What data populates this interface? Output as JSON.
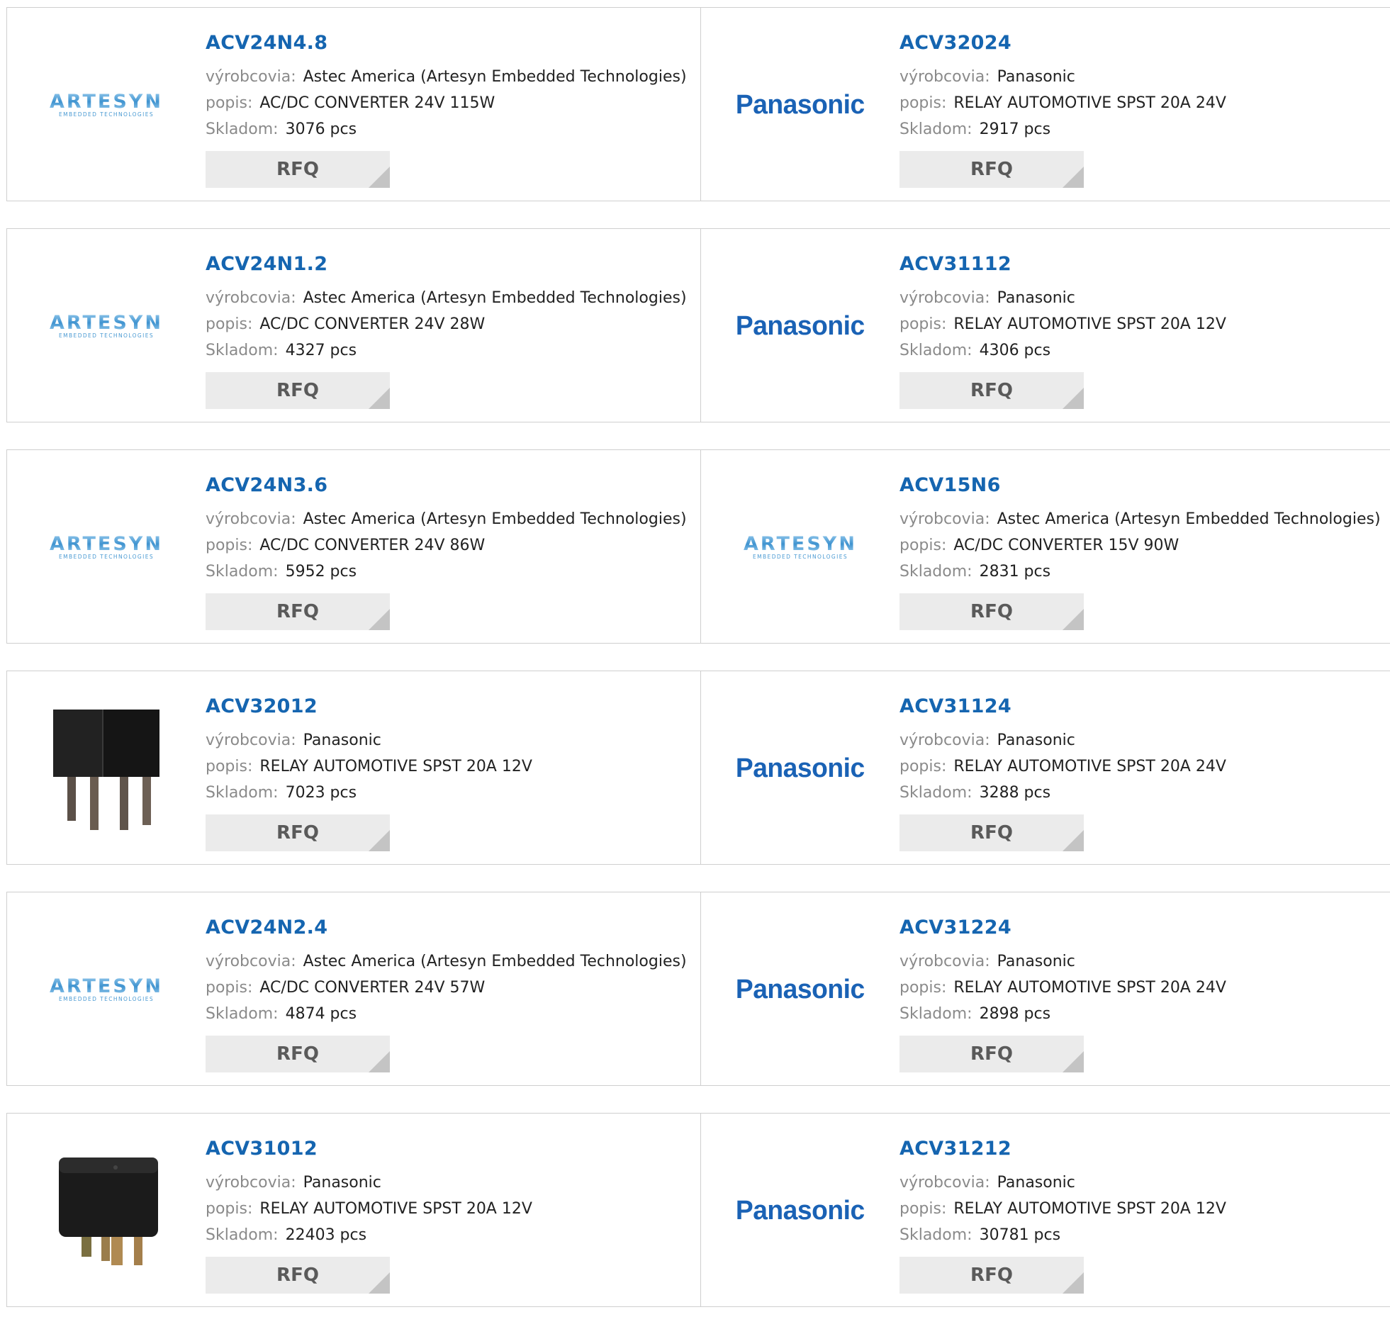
{
  "labels": {
    "manufacturer": "výrobcovia:",
    "description": "popis:",
    "stock": "Skladom:",
    "rfq": "RFQ"
  },
  "brand_colors": {
    "link": "#1565b0",
    "panasonic": "#1a62b5",
    "artesyn": "#5aa5d6"
  },
  "products": [
    {
      "part": "ACV24N4.8",
      "manufacturer": "Astec America (Artesyn Embedded Technologies)",
      "description": "AC/DC CONVERTER 24V 115W",
      "stock": "3076 pcs",
      "image": "artesyn-logo"
    },
    {
      "part": "ACV32024",
      "manufacturer": "Panasonic",
      "description": "RELAY AUTOMOTIVE SPST 20A 24V",
      "stock": "2917 pcs",
      "image": "panasonic-logo"
    },
    {
      "part": "ACV24N1.2",
      "manufacturer": "Astec America (Artesyn Embedded Technologies)",
      "description": "AC/DC CONVERTER 24V 28W",
      "stock": "4327 pcs",
      "image": "artesyn-logo"
    },
    {
      "part": "ACV31112",
      "manufacturer": "Panasonic",
      "description": "RELAY AUTOMOTIVE SPST 20A 12V",
      "stock": "4306 pcs",
      "image": "panasonic-logo"
    },
    {
      "part": "ACV24N3.6",
      "manufacturer": "Astec America (Artesyn Embedded Technologies)",
      "description": "AC/DC CONVERTER 24V 86W",
      "stock": "5952 pcs",
      "image": "artesyn-logo"
    },
    {
      "part": "ACV15N6",
      "manufacturer": "Astec America (Artesyn Embedded Technologies)",
      "description": "AC/DC CONVERTER 15V 90W",
      "stock": "2831 pcs",
      "image": "artesyn-logo"
    },
    {
      "part": "ACV32012",
      "manufacturer": "Panasonic",
      "description": "RELAY AUTOMOTIVE SPST 20A 12V",
      "stock": "7023 pcs",
      "image": "relay-photo-side"
    },
    {
      "part": "ACV31124",
      "manufacturer": "Panasonic",
      "description": "RELAY AUTOMOTIVE SPST 20A 24V",
      "stock": "3288 pcs",
      "image": "panasonic-logo"
    },
    {
      "part": "ACV24N2.4",
      "manufacturer": "Astec America (Artesyn Embedded Technologies)",
      "description": "AC/DC CONVERTER 24V 57W",
      "stock": "4874 pcs",
      "image": "artesyn-logo"
    },
    {
      "part": "ACV31224",
      "manufacturer": "Panasonic",
      "description": "RELAY AUTOMOTIVE SPST 20A 24V",
      "stock": "2898 pcs",
      "image": "panasonic-logo"
    },
    {
      "part": "ACV31012",
      "manufacturer": "Panasonic",
      "description": "RELAY AUTOMOTIVE SPST 20A 12V",
      "stock": "22403 pcs",
      "image": "relay-photo-front"
    },
    {
      "part": "ACV31212",
      "manufacturer": "Panasonic",
      "description": "RELAY AUTOMOTIVE SPST 20A 12V",
      "stock": "30781 pcs",
      "image": "panasonic-logo"
    }
  ]
}
